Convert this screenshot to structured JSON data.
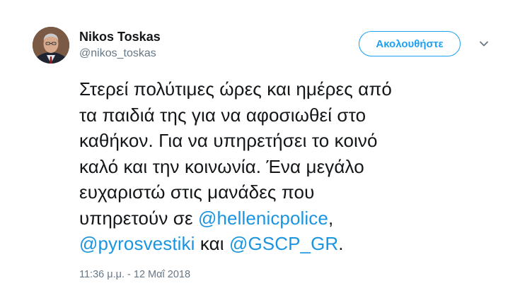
{
  "user": {
    "name": "Nikos Toskas",
    "handle": "@nikos_toskas"
  },
  "actions": {
    "follow_label": "Ακολουθήστε"
  },
  "tweet": {
    "lines": [
      [
        "Στερεί πολύτιμες ώρες και ημέρες από"
      ],
      [
        "τα παιδιά της για να αφοσιωθεί στο"
      ],
      [
        "καθήκον. Για να υπηρετήσει το κοινό"
      ],
      [
        "καλό και την κοινωνία. Ένα μεγάλο"
      ],
      [
        "ευχαριστώ στις μανάδες που"
      ],
      [
        "υπηρετούν σε ",
        "@hellenicpolice",
        ","
      ],
      [
        "@pyrosvestiki",
        " και ",
        "@GSCP_GR",
        "."
      ]
    ],
    "timestamp": "11:36 μ.μ. - 12 Μαΐ 2018"
  },
  "colors": {
    "accent": "#1da1f2",
    "mention": "#1b95e0",
    "secondary_text": "#657786"
  },
  "icons": {
    "caret": "chevron-down-icon",
    "avatar": "avatar"
  }
}
